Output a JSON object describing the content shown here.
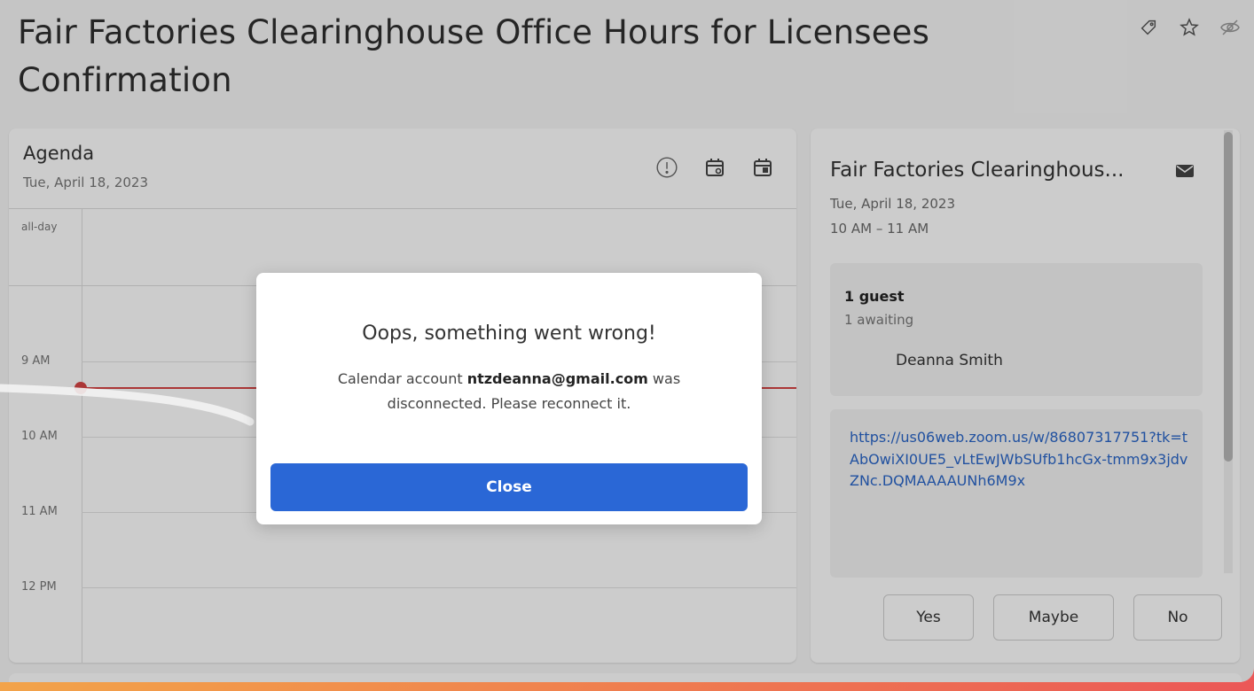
{
  "header": {
    "title": "Fair Factories Clearinghouse Office Hours for Licensees Confirmation",
    "icons": [
      "tag-icon",
      "star-icon",
      "eye-icon"
    ]
  },
  "agenda": {
    "title": "Agenda",
    "date": "Tue, April 18, 2023",
    "allday_label": "all-day",
    "hours": [
      "9 AM",
      "10 AM",
      "11 AM",
      "12 PM"
    ],
    "icons": [
      "alert-icon",
      "calendar-refresh-icon",
      "calendar-icon"
    ]
  },
  "details": {
    "title": "Fair Factories Clearinghous...",
    "date": "Tue, April 18, 2023",
    "time": "10 AM – 11 AM",
    "guests_count": "1 guest",
    "guests_awaiting": "1 awaiting",
    "guest_name": "Deanna Smith",
    "link": "https://us06web.zoom.us/w/86807317751?tk=tAbOwiXI0UE5_vLtEwJWbSUfb1hcGx-tmm9x3jdvZNc.DQMAAAAUNh6M9x",
    "rsvp": {
      "yes": "Yes",
      "maybe": "Maybe",
      "no": "No"
    }
  },
  "dialog": {
    "heading": "Oops, something went wrong!",
    "msg_prefix": "Calendar account ",
    "account": "ntzdeanna@gmail.com",
    "msg_suffix": " was disconnected. Please reconnect it.",
    "close_label": "Close"
  },
  "colors": {
    "accent": "#2a67d6",
    "now_line": "#d64545",
    "link": "#2a66c8"
  }
}
